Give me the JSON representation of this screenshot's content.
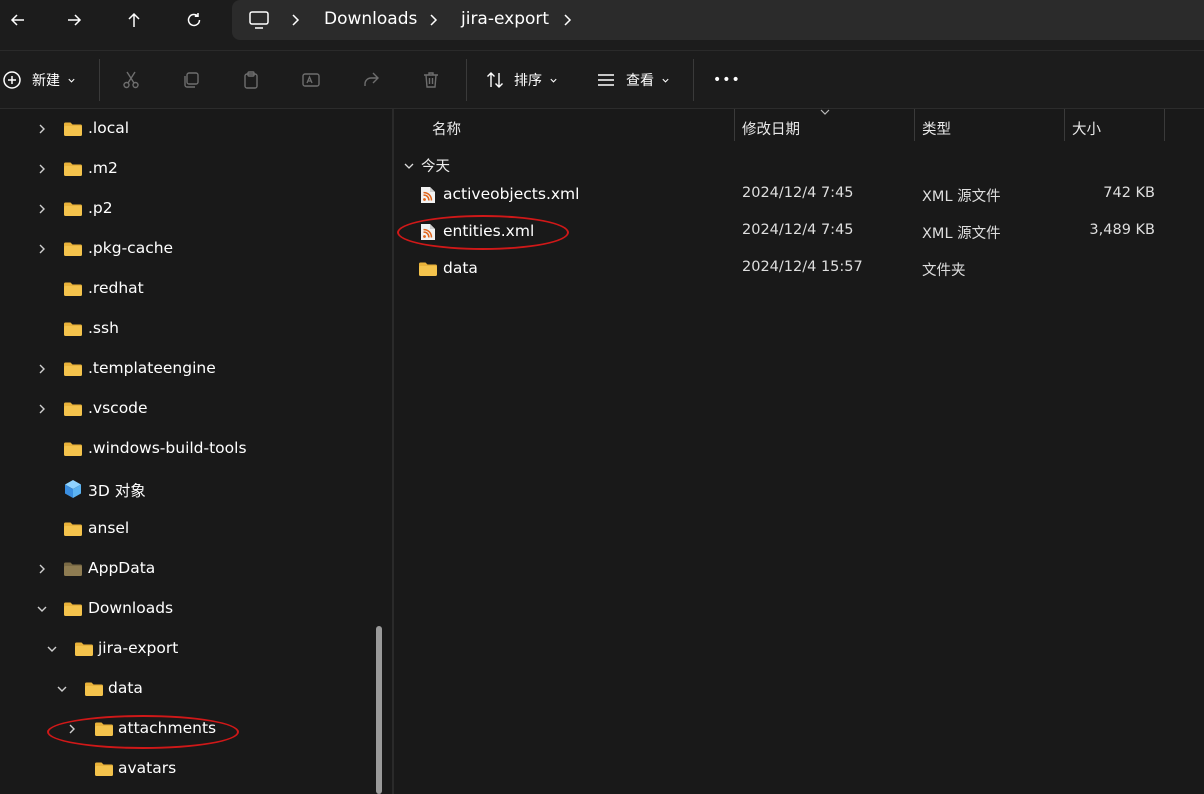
{
  "breadcrumb": {
    "items": [
      "Downloads",
      "jira-export"
    ]
  },
  "toolbar": {
    "new_label": "新建",
    "sort_label": "排序",
    "view_label": "查看",
    "more_label": "•••"
  },
  "nav_tree": {
    "items": [
      {
        "label": ".local",
        "expandable": true
      },
      {
        "label": ".m2",
        "expandable": true
      },
      {
        "label": ".p2",
        "expandable": true
      },
      {
        "label": ".pkg-cache",
        "expandable": true
      },
      {
        "label": ".redhat",
        "expandable": false
      },
      {
        "label": ".ssh",
        "expandable": false
      },
      {
        "label": ".templateengine",
        "expandable": true
      },
      {
        "label": ".vscode",
        "expandable": true
      },
      {
        "label": ".windows-build-tools",
        "expandable": false
      },
      {
        "label": "3D 对象",
        "expandable": false
      },
      {
        "label": "ansel",
        "expandable": false
      },
      {
        "label": "AppData",
        "expandable": true
      },
      {
        "label": "Downloads",
        "expandable": true,
        "expanded": true
      },
      {
        "label": "jira-export",
        "expandable": true,
        "expanded": true
      },
      {
        "label": "data",
        "expandable": true,
        "expanded": true
      },
      {
        "label": "attachments",
        "expandable": true
      },
      {
        "label": "avatars",
        "expandable": false
      }
    ]
  },
  "columns": {
    "name": "名称",
    "modified": "修改日期",
    "type": "类型",
    "size": "大小"
  },
  "group": {
    "label": "今天"
  },
  "files": [
    {
      "name": "activeobjects.xml",
      "modified": "2024/12/4 7:45",
      "type": "XML 源文件",
      "size": "742 KB",
      "icon": "rss-file-icon"
    },
    {
      "name": "entities.xml",
      "modified": "2024/12/4 7:45",
      "type": "XML 源文件",
      "size": "3,489 KB",
      "icon": "rss-file-icon"
    },
    {
      "name": "data",
      "modified": "2024/12/4 15:57",
      "type": "文件夹",
      "size": "",
      "icon": "folder-icon"
    }
  ],
  "colors": {
    "folder": "#f4c34c",
    "annotation": "#d01818",
    "background": "#191919"
  }
}
